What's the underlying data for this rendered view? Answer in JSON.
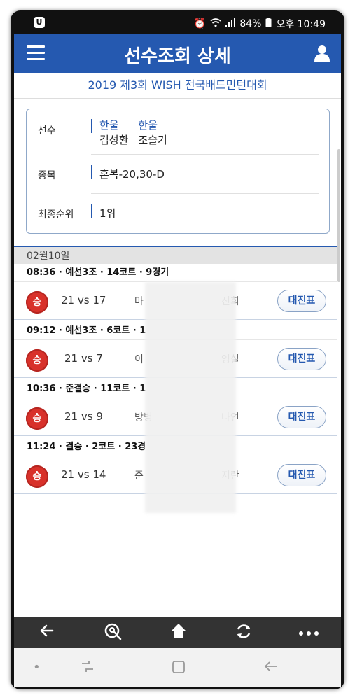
{
  "status": {
    "left_icon": "U",
    "battery": "84%",
    "time": "오후 10:49"
  },
  "appbar": {
    "title": "선수조회 상세"
  },
  "tournament": "2019 제3회 WISH 전국배드민턴대회",
  "info": {
    "player_label": "선수",
    "players": [
      {
        "club": "한울",
        "name": "김성환"
      },
      {
        "club": "한울",
        "name": "조슬기"
      }
    ],
    "event_label": "종목",
    "event_value": "혼복-20,30-D",
    "rank_label": "최종순위",
    "rank_value": "1위"
  },
  "date": "02월10일",
  "matches": [
    {
      "meta": "08:36 · 예선3조 · 14코트 · 9경기",
      "result": "승",
      "score": "21 vs 17",
      "opp1": "마",
      "opp2": "진희",
      "button": "대진표"
    },
    {
      "meta": "09:12 · 예선3조 · 6코트 · 1",
      "result": "승",
      "score": "21 vs 7",
      "opp1": "이",
      "opp2": "영실",
      "button": "대진표"
    },
    {
      "meta": "10:36 · 준결승 · 11코트 · 1",
      "result": "승",
      "score": "21 vs 9",
      "opp1": "방병",
      "opp2": "나연",
      "button": "대진표"
    },
    {
      "meta": "11:24 · 결승 · 2코트 · 23경",
      "result": "승",
      "score": "21 vs 14",
      "opp1": "준",
      "opp2": "지란",
      "button": "대진표"
    }
  ],
  "icons": {
    "back": "back-arrow-icon",
    "search": "zoom-search-icon",
    "home": "home-icon",
    "refresh": "refresh-icon",
    "more": "more-icon"
  },
  "colors": {
    "brand": "#2559b0",
    "win": "#d8312a"
  }
}
